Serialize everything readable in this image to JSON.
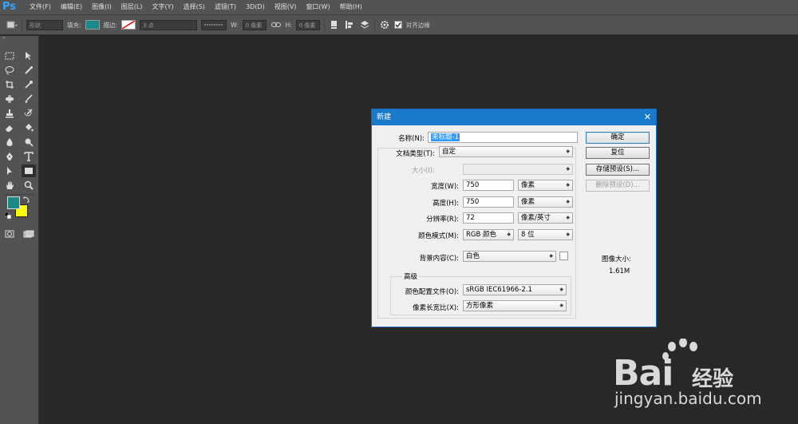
{
  "app": {
    "logo": "Ps"
  },
  "menu": [
    "文件(F)",
    "编辑(E)",
    "图像(I)",
    "图层(L)",
    "文字(Y)",
    "选择(S)",
    "滤镜(T)",
    "3D(D)",
    "视图(V)",
    "窗口(W)",
    "帮助(H)"
  ],
  "options_bar": {
    "shape_mode": "形状",
    "fill_label": "填充:",
    "fill_color": "#1b8a87",
    "stroke_label": "描边:",
    "stroke_width": "3 点",
    "w_label": "W:",
    "w_value": "0 像素",
    "h_label": "H:",
    "h_value": "0 像素",
    "align_edges_label": "对齐边缘"
  },
  "tools": {
    "foreground_color": "#1b8a87",
    "background_color": "#ffff00"
  },
  "dialog": {
    "title": "新建",
    "close": "✕",
    "name_label": "名称(N):",
    "name_value": "未标题-1",
    "doc_type_label": "文档类型(T):",
    "doc_type_value": "自定",
    "size_label": "大小(I):",
    "size_value": "",
    "width_label": "宽度(W):",
    "width_value": "750",
    "width_unit": "像素",
    "height_label": "高度(H):",
    "height_value": "750",
    "height_unit": "像素",
    "resolution_label": "分辨率(R):",
    "resolution_value": "72",
    "resolution_unit": "像素/英寸",
    "color_mode_label": "颜色模式(M):",
    "color_mode_value": "RGB 颜色",
    "bit_depth_value": "8 位",
    "background_label": "背景内容(C):",
    "background_value": "白色",
    "advanced_label": "高级",
    "profile_label": "颜色配置文件(O):",
    "profile_value": "sRGB IEC61966-2.1",
    "aspect_label": "像素长宽比(X):",
    "aspect_value": "方形像素",
    "buttons": {
      "ok": "确定",
      "reset": "复位",
      "save_preset": "存储预设(S)...",
      "delete_preset": "删除预设(D)..."
    },
    "image_size_label": "图像大小:",
    "image_size_value": "1.61M"
  },
  "watermark": {
    "brand": "Bai",
    "brand_suffix": "经验",
    "url": "jingyan.baidu.com"
  }
}
